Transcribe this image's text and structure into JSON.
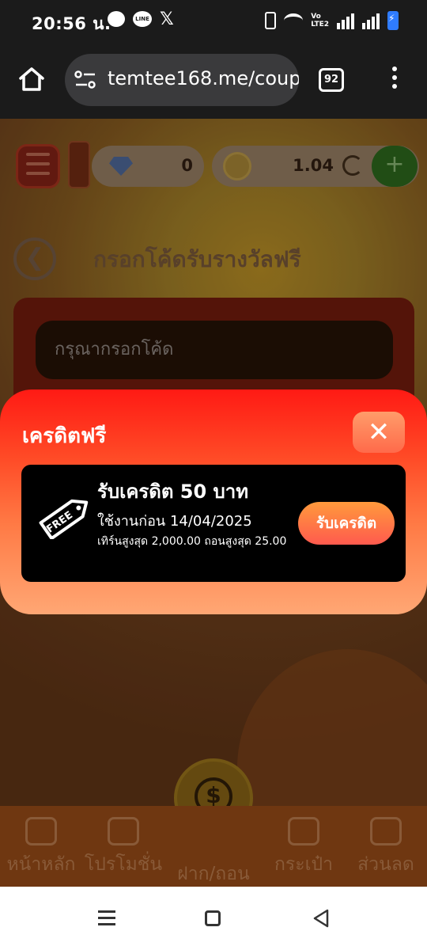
{
  "status_bar": {
    "time": "20:56 น.",
    "app_icons": [
      "chat-bubble-icon",
      "line-icon",
      "x-icon"
    ],
    "line_text": "LINE",
    "x_text": "𝕏",
    "volte_text": "Vo\nLTE2",
    "system_icons": [
      "vibrate-icon",
      "wifi-icon",
      "volte-icon",
      "signal-icon",
      "signal-icon",
      "battery-charging-icon"
    ]
  },
  "browser": {
    "url": "temtee168.me/coup",
    "tab_count": "92",
    "icons": [
      "home-icon",
      "site-settings-icon",
      "tabs-icon",
      "more-icon"
    ]
  },
  "page": {
    "gems_value": "0",
    "coins_value": "1.04",
    "title": "กรอกโค้ดรับรางวัลฟรี",
    "code_placeholder": "กรุณากรอกโค้ด",
    "back_symbol": "❮",
    "plus_symbol": "+",
    "center_symbol": "$"
  },
  "bottom_nav": {
    "items": [
      {
        "label": "หน้าหลัก",
        "icon": "home-icon"
      },
      {
        "label": "โปรโมชั่น",
        "icon": "promotion-icon"
      },
      {
        "label": "ฝาก/ถอน",
        "icon": "deposit-withdraw-icon"
      },
      {
        "label": "กระเป๋า",
        "icon": "wallet-icon"
      },
      {
        "label": "ส่วนลด",
        "icon": "discount-icon"
      }
    ]
  },
  "modal": {
    "title": "เครดิตฟรี",
    "close_symbol": "✕",
    "coupon": {
      "tag_text": "FREE",
      "title": "รับเครดิต 50 บาท",
      "expiry": "ใช้งานก่อน 14/04/2025",
      "limits": "เทิร์นสูงสุด 2,000.00 ถอนสูงสุด 25.00",
      "claim_label": "รับเครดิต"
    }
  },
  "colors": {
    "modal_top": "#ff1a14",
    "modal_bottom": "#ffa774",
    "claim_button": "#ff6a4a",
    "coupon_bg": "#000000"
  }
}
